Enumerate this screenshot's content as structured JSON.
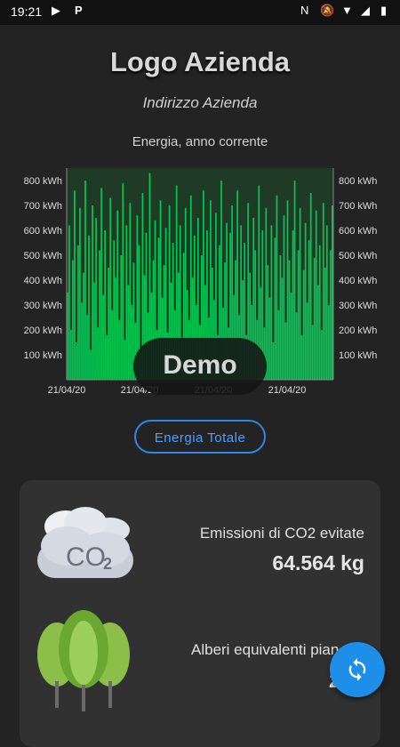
{
  "status_bar": {
    "time": "19:21"
  },
  "header": {
    "logo_text": "Logo Azienda",
    "address": "Indirizzo Azienda"
  },
  "chart": {
    "title": "Energia, anno corrente",
    "demo_label": "Demo",
    "bar_color": "#00c853"
  },
  "chart_data": {
    "type": "bar",
    "title": "Energia, anno corrente",
    "xlabel": "",
    "ylabel": "",
    "ylim": [
      0,
      850
    ],
    "y_ticks": [
      "100 kWh",
      "200 kWh",
      "300 kWh",
      "400 kWh",
      "500 kWh",
      "600 kWh",
      "700 kWh",
      "800 kWh"
    ],
    "x_tick_labels": [
      "21/04/20",
      "21/04/20",
      "21/04/20",
      "21/04/20"
    ],
    "values": [
      350,
      620,
      200,
      480,
      760,
      150,
      540,
      690,
      310,
      430,
      800,
      260,
      580,
      120,
      700,
      390,
      650,
      210,
      520,
      770,
      340,
      600,
      180,
      450,
      730,
      280,
      560,
      410,
      680,
      240,
      500,
      790,
      160,
      620,
      380,
      710,
      300,
      470,
      230,
      660,
      540,
      110,
      750,
      420,
      590,
      270,
      830,
      350,
      480,
      640,
      200,
      570,
      720,
      330,
      460,
      610,
      190,
      700,
      390,
      550,
      280,
      780,
      430,
      620,
      170,
      510,
      690,
      360,
      240,
      740,
      410,
      580,
      300,
      650,
      220,
      500,
      760,
      380,
      600,
      250,
      720,
      450,
      320,
      670,
      180,
      540,
      800,
      290,
      470,
      630,
      210,
      590,
      700,
      340,
      480,
      760,
      260,
      620,
      400,
      550,
      180,
      710,
      430,
      300,
      650,
      520,
      240,
      780,
      370,
      600,
      210,
      690,
      460,
      330,
      620,
      150,
      570,
      740,
      280,
      500,
      410,
      660,
      230,
      720,
      480,
      350,
      600,
      800,
      270,
      520,
      690,
      180,
      440,
      630,
      310,
      560,
      750,
      220,
      490,
      680,
      380,
      540,
      200,
      710,
      450,
      620,
      300,
      520,
      700
    ]
  },
  "buttons": {
    "total_energy": "Energia Totale"
  },
  "stats": {
    "co2_label": "Emissioni di CO2 evitate",
    "co2_value": "64.564 kg",
    "co2_icon_text": "CO",
    "co2_icon_sub": "2",
    "trees_label": "Alberi equivalenti pian",
    "trees_value": "2"
  },
  "colors": {
    "background": "#232323",
    "card": "#313131",
    "accent": "#2e86e8",
    "fab": "#1e8fe8",
    "bars": "#00c853"
  }
}
